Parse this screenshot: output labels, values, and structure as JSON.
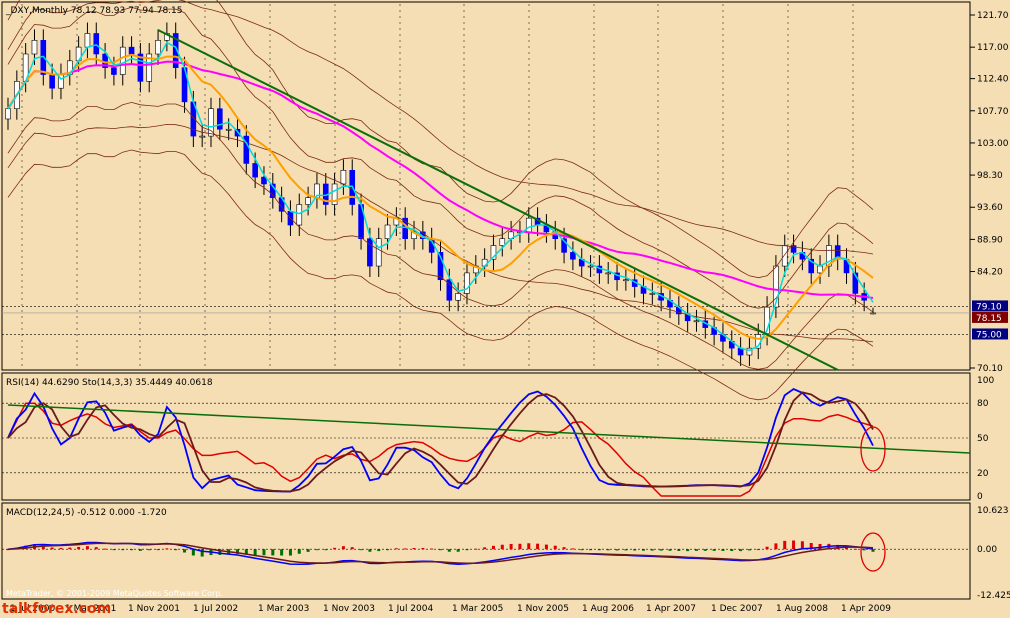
{
  "colors": {
    "background": "#f5deb3",
    "frame": "#000000",
    "grid": "#000000",
    "bull": "#ffffff",
    "bear": "#0000ff",
    "ma_fast": "#00dcdc",
    "ma_mid": "#ffa000",
    "ma_slow": "#ff00ff",
    "envelope": "#7b2b10",
    "trendline": "#0a6e0a",
    "rsi_line": "#e00000",
    "stoch_main": "#0000ff",
    "stoch_signal": "#6b1a1a",
    "macd_pos": "#e00000",
    "macd_neg": "#007000",
    "circle": "#e00000",
    "current_price_box": "#800000",
    "level_box": "#000080",
    "watermark": "#e03000"
  },
  "main_panel": {
    "header": "_DXY,Monthly  78.12 78.93 77.94 78.15",
    "y_ticks": [
      "121.70",
      "117.00",
      "112.40",
      "107.70",
      "103.00",
      "98.30",
      "93.60",
      "88.90",
      "84.20",
      "79.10",
      "78.15",
      "75.00",
      "70.10"
    ],
    "current_price": "78.15",
    "marked_level": "79.10",
    "level_75": "75.00"
  },
  "rsi_panel": {
    "header": "RSI(14) 44.6290  Sto(14,3,3) 35.4449 40.0618",
    "y_ticks": [
      "100",
      "80",
      "50",
      "20",
      "0"
    ]
  },
  "macd_panel": {
    "header": "MACD(12,24,5) -0.512 0.000 -1.720",
    "y_ticks": [
      "10.623",
      "0.00",
      "-12.425"
    ]
  },
  "x_ticks": [
    "1 Jul 2000",
    "1 Mar 2001",
    "1 Nov 2001",
    "1 Jul 2002",
    "1 Mar 2003",
    "1 Nov 2003",
    "1 Jul 2004",
    "1 Mar 2005",
    "1 Nov 2005",
    "1 Aug 2006",
    "1 Apr 2007",
    "1 Dec 2007",
    "1 Aug 2008",
    "1 Apr 2009"
  ],
  "watermark": {
    "site": "talkforex.com",
    "copyright": "MetaTrader, © 2001-2009 MetaQuotes Software Corp."
  },
  "chart_data": {
    "type": "candlestick",
    "symbol": "_DXY",
    "timeframe": "Monthly",
    "ylim": [
      70.1,
      121.7
    ],
    "last_bar": {
      "open": 78.12,
      "high": 78.93,
      "low": 77.94,
      "close": 78.15
    },
    "closes": [
      108,
      112,
      116,
      118,
      113,
      111,
      113,
      115,
      117,
      119,
      116,
      114,
      113,
      117,
      116,
      112,
      116,
      118,
      119,
      114,
      109,
      104,
      104,
      108,
      105,
      105,
      104,
      100,
      98,
      97,
      95,
      93,
      91,
      94,
      95,
      97,
      94,
      97,
      99,
      94,
      89,
      85,
      89,
      91,
      92,
      89,
      90,
      89,
      87,
      83,
      80,
      81,
      84,
      85,
      86,
      88,
      89,
      90,
      90,
      92,
      91,
      90,
      89,
      87,
      86,
      85,
      85,
      84,
      84,
      83,
      83,
      82,
      81,
      81,
      80,
      79,
      78,
      77,
      77,
      76,
      75,
      74,
      73,
      72,
      73,
      75,
      79,
      85,
      88,
      87,
      86,
      84,
      85,
      88,
      86,
      84,
      81,
      80,
      78.15
    ],
    "rsi_panel": {
      "rsi_label": "RSI(14)",
      "rsi_value": 44.629,
      "stoch_label": "Sto(14,3,3)",
      "stoch_main": 35.4449,
      "stoch_signal": 40.0618,
      "levels": [
        80,
        50,
        20
      ]
    },
    "macd_panel": {
      "label": "MACD(12,24,5)",
      "values": [
        -0.512,
        0.0,
        -1.72
      ]
    }
  }
}
